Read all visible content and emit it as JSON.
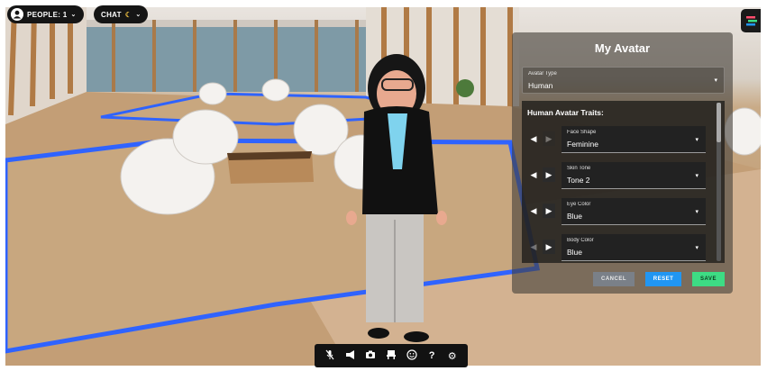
{
  "top_bar": {
    "people_label": "PEOPLE: 1",
    "chat_label": "CHAT",
    "people_icon": "person-circle-icon",
    "chat_icon": "moon-icon",
    "dropdown_icon": "chevron-down-icon",
    "app_icon": "app-menu-icon"
  },
  "avatar_panel": {
    "title": "My Avatar",
    "avatar_type": {
      "label": "Avatar Type",
      "value": "Human"
    },
    "traits_title": "Human Avatar Traits:",
    "traits": [
      {
        "label": "Face Shape",
        "value": "Feminine"
      },
      {
        "label": "Skin Tone",
        "value": "Tone 2"
      },
      {
        "label": "Eye Color",
        "value": "Blue"
      },
      {
        "label": "Body Color",
        "value": "Blue"
      }
    ],
    "buttons": {
      "cancel": "CANCEL",
      "reset": "RESET",
      "save": "SAVE"
    },
    "colors": {
      "reset": "#2196f3",
      "save": "#3ddc84",
      "cancel": "#7a8088"
    }
  },
  "toolbar": {
    "icons": [
      "mic-muted-icon",
      "megaphone-icon",
      "camera-icon",
      "seat-icon",
      "emoji-icon",
      "help-icon",
      "gear-icon"
    ]
  },
  "scene": {
    "floor_outline_color": "#2f63ff"
  }
}
